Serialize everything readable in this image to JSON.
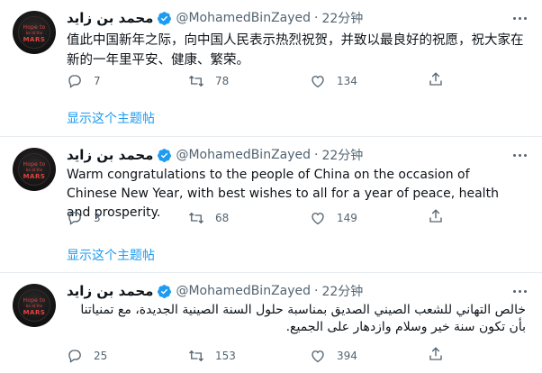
{
  "colors": {
    "accent": "#1d9bf0",
    "muted": "#536471",
    "text": "#0f1419",
    "divider": "#e6ecf0"
  },
  "tweets": [
    {
      "author_name": "محمد بن زايد",
      "handle": "@MohamedBinZayed",
      "separator": "·",
      "time": "22分钟",
      "text": "值此中国新年之际，向中国人民表示热烈祝贺，并致以最良好的祝愿，祝大家在新的一年里平安、健康、繁荣。",
      "replies": "7",
      "retweets": "78",
      "likes": "134",
      "show_thread": "显示这个主题帖"
    },
    {
      "author_name": "محمد بن زايد",
      "handle": "@MohamedBinZayed",
      "separator": "·",
      "time": "22分钟",
      "text": "Warm congratulations to the people of China on the occasion of Chinese New Year, with best wishes to all for a year of peace, health and prosperity.",
      "replies": "3",
      "retweets": "68",
      "likes": "149",
      "show_thread": "显示这个主题帖"
    },
    {
      "author_name": "محمد بن زايد",
      "handle": "@MohamedBinZayed",
      "separator": "·",
      "time": "22分钟",
      "text": "خالص التهاني للشعب الصيني الصديق بمناسبة حلول السنة الصينية الجديدة، مع تمنياتنا بأن تكون سنة خير وسلام وازدهار على الجميع.",
      "replies": "25",
      "retweets": "153",
      "likes": "394"
    }
  ],
  "avatar": {
    "line1": "Hope to",
    "line2": "be at the",
    "line3": "MARS"
  }
}
